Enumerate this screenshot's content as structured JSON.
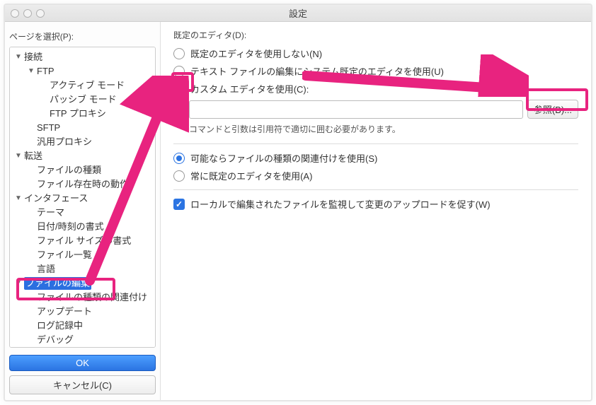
{
  "window": {
    "title": "設定"
  },
  "sidebar": {
    "label": "ページを選択(P):",
    "nodes": [
      {
        "id": "conn",
        "label": "接続",
        "level": 0,
        "expandable": true
      },
      {
        "id": "ftp",
        "label": "FTP",
        "level": 1,
        "expandable": true
      },
      {
        "id": "active",
        "label": "アクティブ モード",
        "level": 2,
        "expandable": false
      },
      {
        "id": "passive",
        "label": "パッシブ モード",
        "level": 2,
        "expandable": false
      },
      {
        "id": "ftpproxy",
        "label": "FTP プロキシ",
        "level": 2,
        "expandable": false
      },
      {
        "id": "sftp",
        "label": "SFTP",
        "level": 1,
        "expandable": false
      },
      {
        "id": "genproxy",
        "label": "汎用プロキシ",
        "level": 1,
        "expandable": false
      },
      {
        "id": "transfer",
        "label": "転送",
        "level": 0,
        "expandable": true
      },
      {
        "id": "filetypes",
        "label": "ファイルの種類",
        "level": 1,
        "expandable": false
      },
      {
        "id": "fileexist",
        "label": "ファイル存在時の動作",
        "level": 1,
        "expandable": false
      },
      {
        "id": "interface",
        "label": "インタフェース",
        "level": 0,
        "expandable": true
      },
      {
        "id": "theme",
        "label": "テーマ",
        "level": 1,
        "expandable": false
      },
      {
        "id": "dateformat",
        "label": "日付/時刻の書式",
        "level": 1,
        "expandable": false
      },
      {
        "id": "sizeformat",
        "label": "ファイル サイズの書式",
        "level": 1,
        "expandable": false
      },
      {
        "id": "filelist",
        "label": "ファイル一覧",
        "level": 1,
        "expandable": false
      },
      {
        "id": "lang",
        "label": "言語",
        "level": 1,
        "expandable": false
      },
      {
        "id": "fileedit",
        "label": "ファイルの編集",
        "level": 0,
        "expandable": true,
        "selected": true
      },
      {
        "id": "assoc",
        "label": "ファイルの種類の関連付け",
        "level": 1,
        "expandable": false
      },
      {
        "id": "update",
        "label": "アップデート",
        "level": 1,
        "expandable": false
      },
      {
        "id": "logging",
        "label": "ログ記録中",
        "level": 1,
        "expandable": false
      },
      {
        "id": "debug",
        "label": "デバッグ",
        "level": 1,
        "expandable": false
      }
    ],
    "ok": "OK",
    "cancel": "キャンセル(C)"
  },
  "content": {
    "default_editor_label": "既定のエディタ(D):",
    "opt_none": "既定のエディタを使用しない(N)",
    "opt_system": "テキスト ファイルの編集にシステム既定のエディタを使用(U)",
    "opt_custom": "カスタム エディタを使用(C):",
    "browse": "参照(B)...",
    "path_hint": "コマンドと引数は引用符で適切に囲む必要があります。",
    "opt_assoc": "可能ならファイルの種類の関連付けを使用(S)",
    "opt_always": "常に既定のエディタを使用(A)",
    "chk_watch": "ローカルで編集されたファイルを監視して変更のアップロードを促す(W)",
    "editor_path": ""
  }
}
